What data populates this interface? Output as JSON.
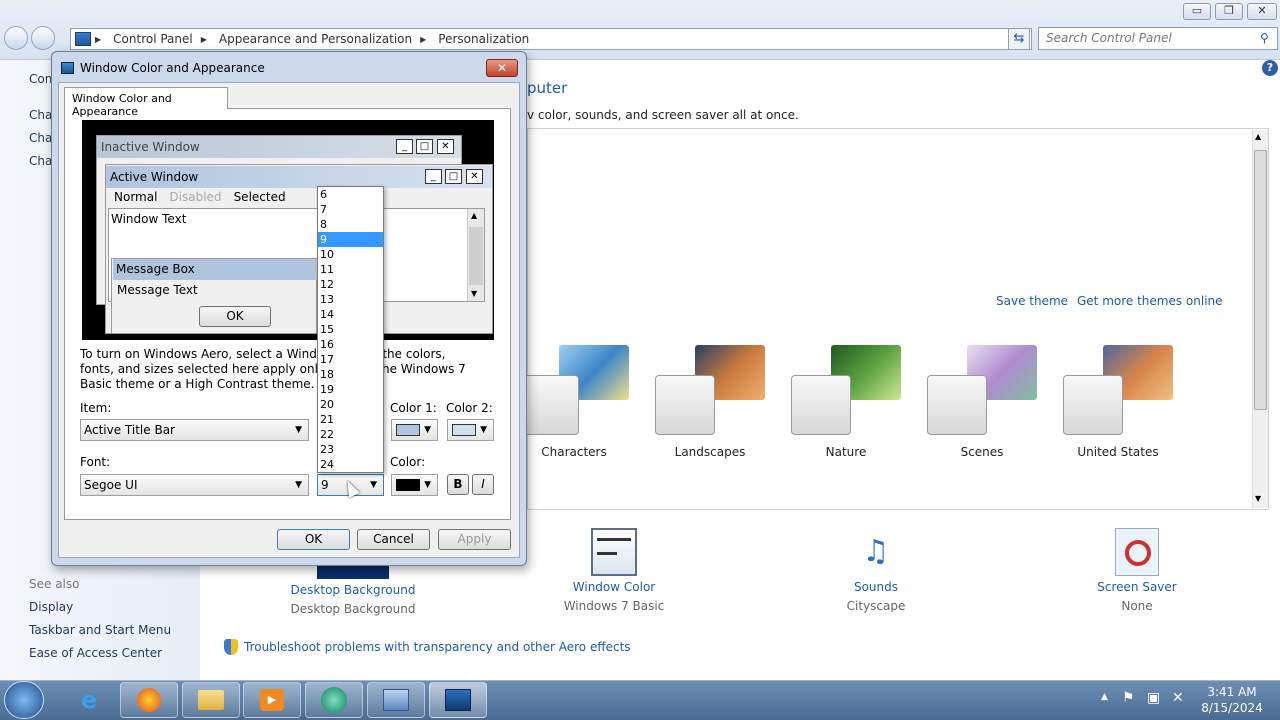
{
  "explorer": {
    "breadcrumb": [
      "Control Panel",
      "Appearance and Personalization",
      "Personalization"
    ],
    "search_placeholder": "Search Control Panel",
    "window_buttons": [
      "▭",
      "❐",
      "✕"
    ]
  },
  "leftpane": {
    "partial_items": [
      "Con",
      "Cha",
      "Cha",
      "Cha"
    ],
    "see_also_title": "See also",
    "see_also": [
      "Display",
      "Taskbar and Start Menu",
      "Ease of Access Center"
    ]
  },
  "main": {
    "heading_partial": "puter",
    "subheading_partial": "v color, sounds, and screen saver all at once.",
    "save_theme": "Save theme",
    "more_themes": "Get more themes online",
    "themes": [
      {
        "name": "Characters",
        "color": "#6aa6d8"
      },
      {
        "name": "Landscapes",
        "color": "#c77a3b"
      },
      {
        "name": "Nature",
        "color": "#5aa040"
      },
      {
        "name": "Scenes",
        "color": "#b08ad0"
      },
      {
        "name": "United States",
        "color": "#d8834a"
      }
    ],
    "bottom_items": [
      {
        "title": "Desktop Background",
        "value": "Desktop Background"
      },
      {
        "title": "Window Color",
        "value": "Windows 7 Basic"
      },
      {
        "title": "Sounds",
        "value": "Cityscape"
      },
      {
        "title": "Screen Saver",
        "value": "None"
      }
    ],
    "troubleshoot": "Troubleshoot problems with transparency and other Aero effects"
  },
  "dialog": {
    "title": "Window Color and Appearance",
    "tab": "Window Color and Appearance",
    "inactive_title": "Inactive Window",
    "active_title": "Active Window",
    "menu": [
      "Normal",
      "Disabled",
      "Selected"
    ],
    "window_text": "Window Text",
    "message_box": "Message Box",
    "message_text": "Message Text",
    "preview_ok": "OK",
    "description": "To turn on Windows Aero, select a Windows me of the colors, fonts, and sizes selected here apply only if yo ed the Windows 7 Basic theme or a High Contrast theme.",
    "item_label": "Item:",
    "item_value": "Active Title Bar",
    "size_label": "",
    "color1_label": "Color 1:",
    "color2_label": "Color 2:",
    "font_label": "Font:",
    "font_value": "Segoe UI",
    "font_size_value": "9",
    "color_label": "Color:",
    "bold": "B",
    "italic": "I",
    "ok": "OK",
    "cancel": "Cancel",
    "apply": "Apply",
    "font_sizes": [
      "6",
      "7",
      "8",
      "9",
      "10",
      "11",
      "12",
      "13",
      "14",
      "15",
      "16",
      "17",
      "18",
      "19",
      "20",
      "21",
      "22",
      "23",
      "24"
    ],
    "selected_size": "9"
  },
  "tray": {
    "time": "3:41 AM",
    "date": "8/15/2024"
  }
}
